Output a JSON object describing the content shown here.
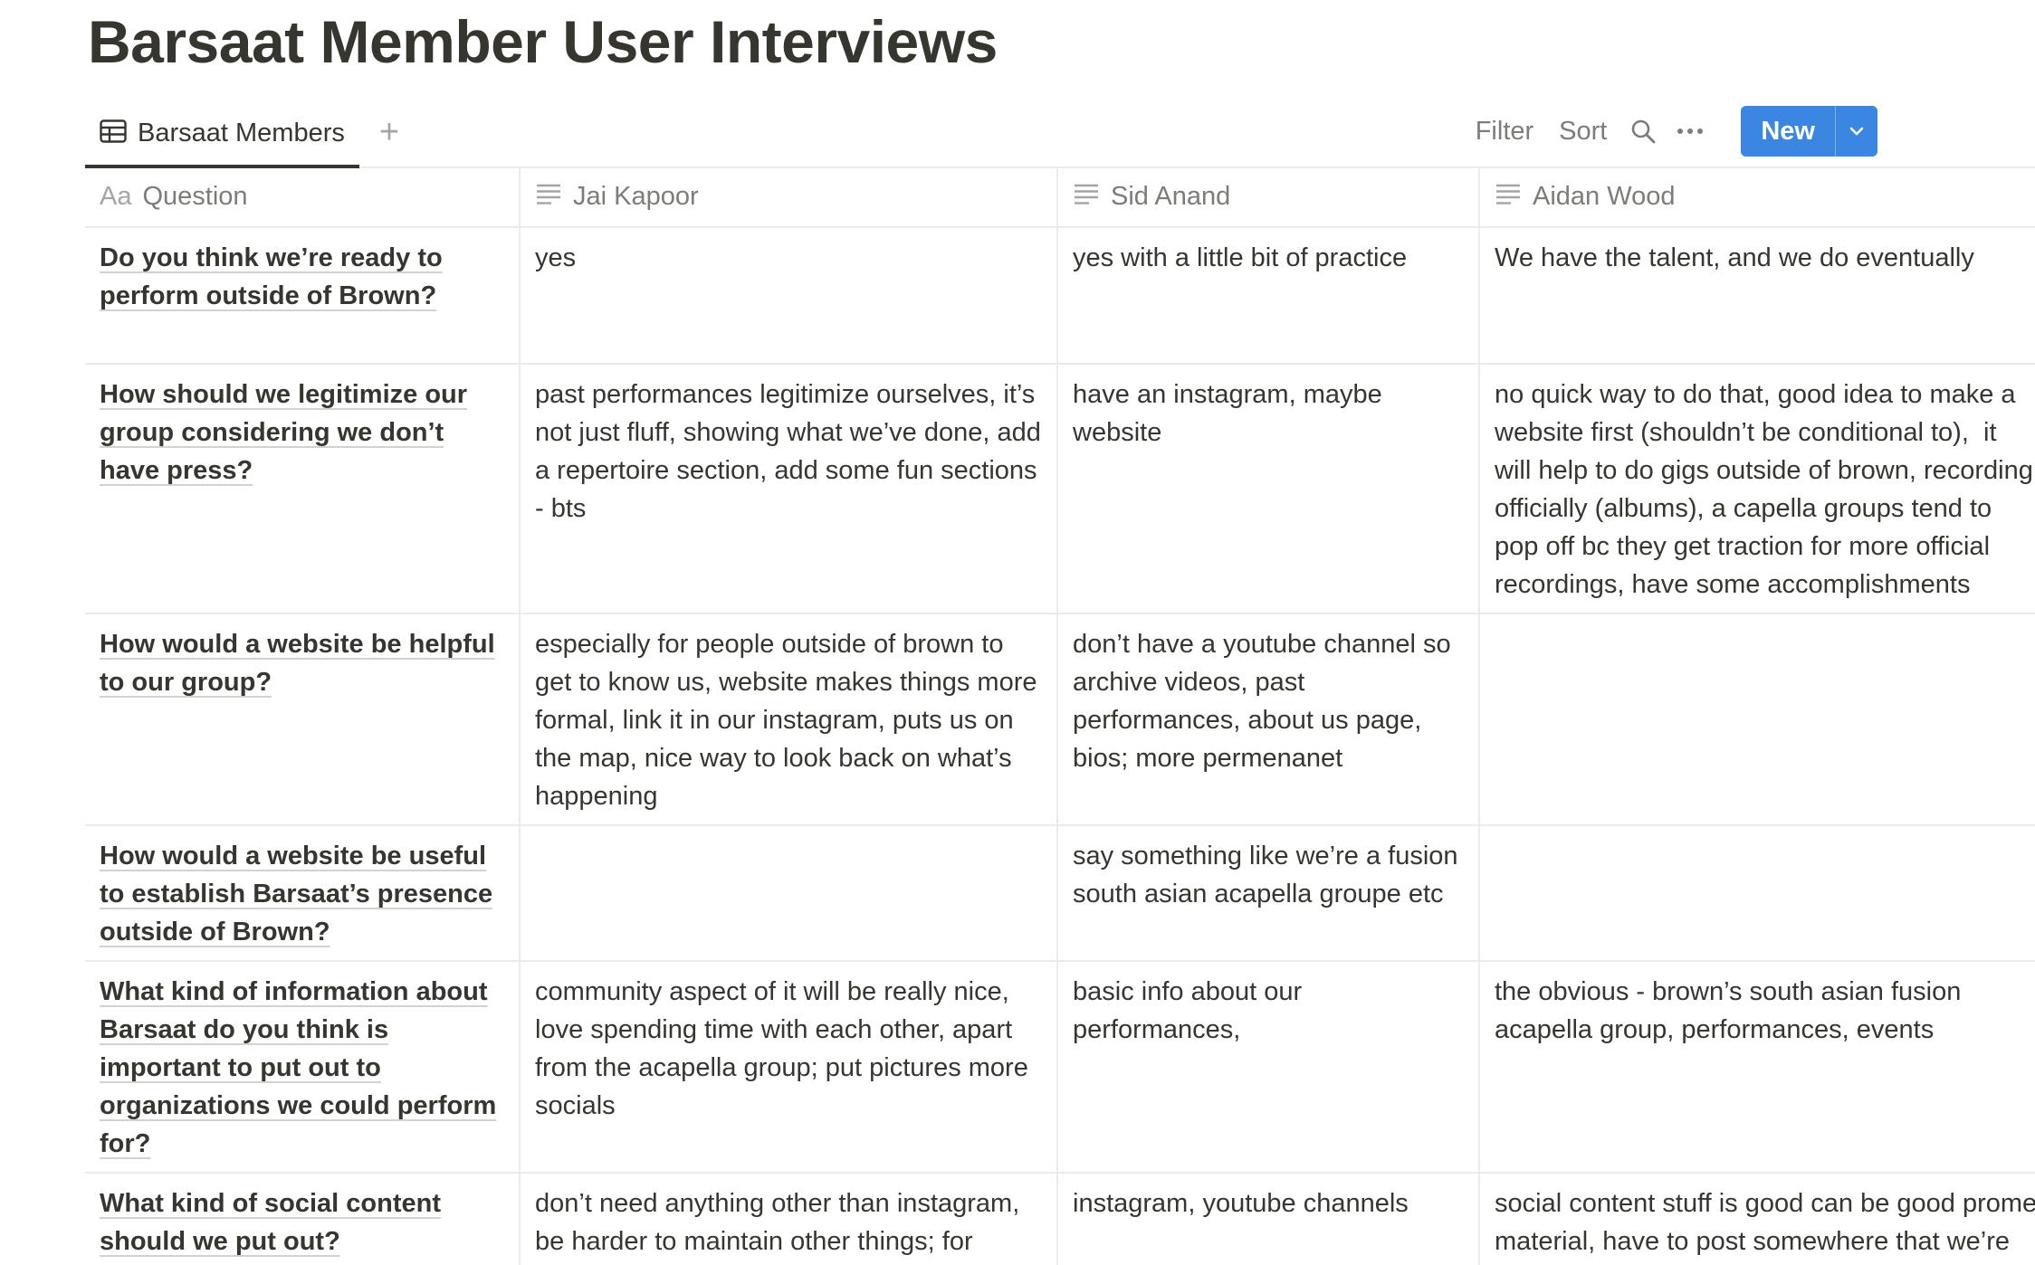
{
  "page": {
    "title": "Barsaat Member User Interviews"
  },
  "view": {
    "tab_label": "Barsaat Members",
    "add_view_label": "+",
    "filter_label": "Filter",
    "sort_label": "Sort",
    "new_label": "New"
  },
  "table": {
    "columns": [
      {
        "icon": "Aa",
        "label": "Question"
      },
      {
        "icon": "text-lines-icon",
        "label": "Jai Kapoor"
      },
      {
        "icon": "text-lines-icon",
        "label": "Sid Anand"
      },
      {
        "icon": "text-lines-icon",
        "label": "Aidan Wood"
      }
    ],
    "rows": [
      {
        "question": "Do you think we’re ready to perform outside of Brown?",
        "jai": "yes",
        "sid": "yes with a little bit of practice",
        "aidan": "We have the talent, and we do eventually"
      },
      {
        "question": "How should we legitimize our group considering we don’t have press?",
        "jai": "past performances legitimize ourselves, it’s not just fluff, showing what we’ve done, add a repertoire section, add some fun sections - bts",
        "sid": "have an instagram, maybe website",
        "aidan": "no quick way to do that, good idea to make a\nwebsite first (shouldn’t be conditional to),  it\nwill help to do gigs outside of brown, recording\nofficially (albums), a capella groups tend to\npop off bc they get traction for more official\nrecordings, have some accomplishments"
      },
      {
        "question": "How would a website be helpful to our group?",
        "jai": "especially for people outside of brown to get to know us, website makes things more formal, link it in our instagram, puts us on the map, nice way to look back on what’s happening",
        "sid": "don’t have a youtube channel so archive videos, past performances, about us page, bios; more permenanet",
        "aidan": ""
      },
      {
        "question": "How would a website be useful to establish Barsaat’s presence outside of Brown?",
        "jai": "",
        "sid": "say something like we’re a fusion south asian acapella groupe etc",
        "aidan": ""
      },
      {
        "question": "What kind of information about Barsaat do you think is important to put out to organizations we could perform for?",
        "jai": "community aspect of it will be really nice, love spending time with each other, apart from the acapella group; put pictures more socials",
        "sid": "basic info about our performances,",
        "aidan": "the obvious - brown’s south asian fusion\nacapella group, performances, events"
      },
      {
        "question": "What kind of social content should we put out?",
        "jai": "don’t need anything other than instagram, be harder to maintain other things; for",
        "sid": "instagram, youtube channels",
        "aidan": "social content stuff is good can be good prome\nmaterial, have to post somewhere that we’re"
      }
    ]
  },
  "colors": {
    "text": "#37352f",
    "muted": "#7d7c78",
    "border": "#ebebea",
    "accent": "#2383e2"
  }
}
